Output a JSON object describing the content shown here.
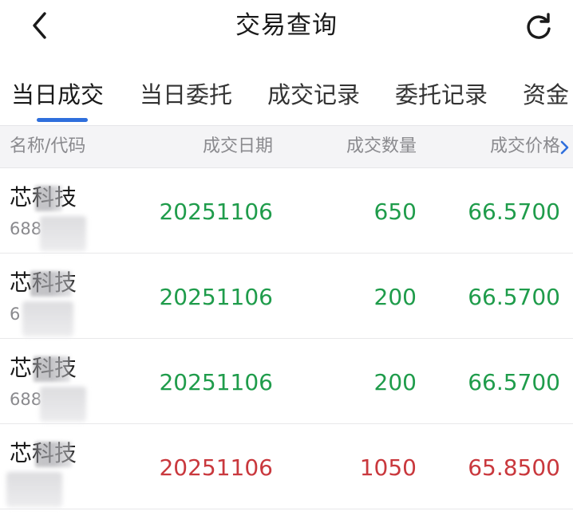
{
  "header": {
    "title": "交易查询"
  },
  "tabs": [
    {
      "label": "当日成交",
      "active": true
    },
    {
      "label": "当日委托",
      "active": false
    },
    {
      "label": "成交记录",
      "active": false
    },
    {
      "label": "委托记录",
      "active": false
    },
    {
      "label": "资金",
      "active": false
    }
  ],
  "table": {
    "columns": [
      "名称/代码",
      "成交日期",
      "成交数量",
      "成交价格"
    ],
    "rows": [
      {
        "name": "芯科技",
        "code": "688",
        "date": "20251106",
        "quantity": "650",
        "price": "66.5700",
        "direction": "buy"
      },
      {
        "name": "芯科技",
        "code": "6",
        "date": "20251106",
        "quantity": "200",
        "price": "66.5700",
        "direction": "buy"
      },
      {
        "name": "芯科技",
        "code": "688",
        "date": "20251106",
        "quantity": "200",
        "price": "66.5700",
        "direction": "buy"
      },
      {
        "name": "芯科技",
        "code": "",
        "date": "20251106",
        "quantity": "1050",
        "price": "65.8500",
        "direction": "sell"
      }
    ]
  },
  "colors": {
    "buy": "#1f9c4b",
    "sell": "#c9383d",
    "accent": "#2f6fdc"
  },
  "icons": {
    "back": "chevron-left-icon",
    "refresh": "refresh-icon",
    "more_columns": "chevron-right-icon"
  }
}
